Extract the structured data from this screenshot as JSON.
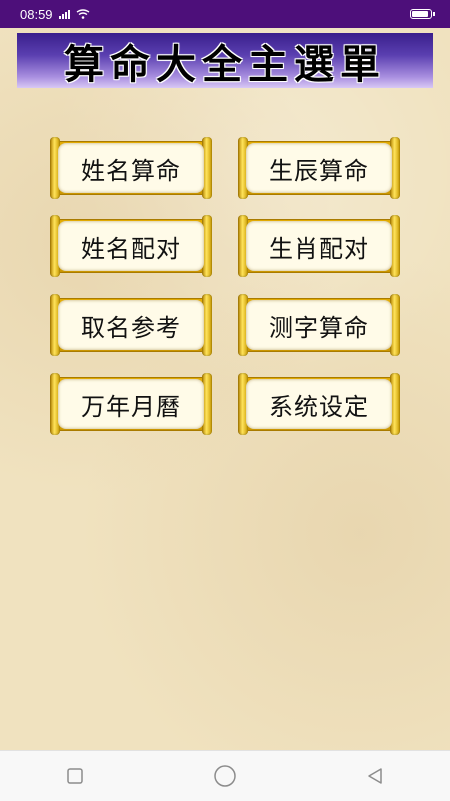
{
  "status_bar": {
    "time": "08:59",
    "signal_icon": "cell-signal-icon",
    "wifi_icon": "wifi-icon",
    "battery_icon": "battery-charging-icon",
    "background": "#4d0f7a"
  },
  "banner": {
    "title": "算命大全主選單"
  },
  "menu": {
    "items": [
      {
        "label": "姓名算命"
      },
      {
        "label": "生辰算命"
      },
      {
        "label": "姓名配对"
      },
      {
        "label": "生肖配对"
      },
      {
        "label": "取名参考"
      },
      {
        "label": "测字算命"
      },
      {
        "label": "万年月曆"
      },
      {
        "label": "系统设定"
      }
    ]
  },
  "nav_bar": {
    "recents_icon": "square-recents-icon",
    "home_icon": "circle-home-icon",
    "back_icon": "triangle-back-icon"
  }
}
